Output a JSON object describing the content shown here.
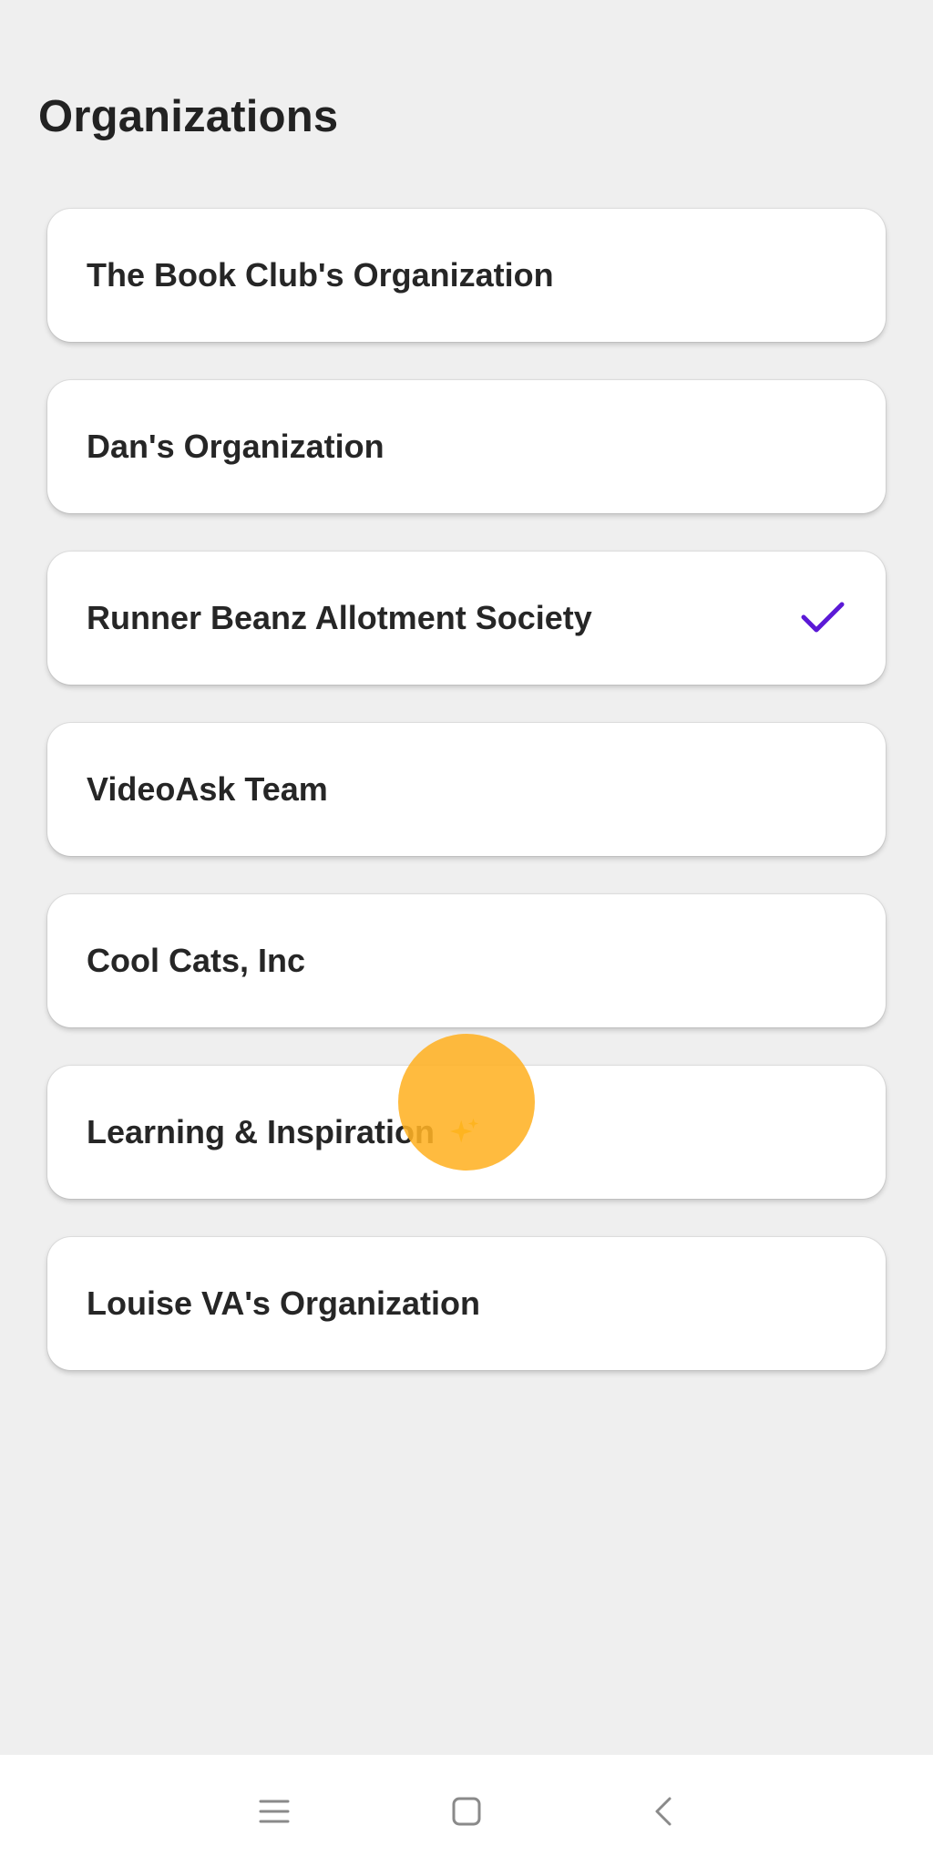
{
  "page": {
    "title": "Organizations"
  },
  "organizations": [
    {
      "name": "The Book Club's Organization",
      "selected": false
    },
    {
      "name": "Dan's Organization",
      "selected": false
    },
    {
      "name": "Runner Beanz Allotment Society",
      "selected": true
    },
    {
      "name": "VideoAsk Team",
      "selected": false
    },
    {
      "name": "Cool Cats, Inc",
      "selected": false
    },
    {
      "name": "Learning & Inspiration",
      "selected": false,
      "badge_icon": "sparkle-icon"
    },
    {
      "name": "Louise VA's Organization",
      "selected": false
    }
  ],
  "icons": {
    "selected": "checkmark-icon",
    "nav_menu": "menu-icon",
    "nav_home": "home-square-icon",
    "nav_back": "back-chevron-icon"
  },
  "colors": {
    "background": "#efefef",
    "card": "#ffffff",
    "text": "#262626",
    "accent_check": "#5b19d6",
    "touch_indicator": "#ffb224",
    "nav_icons": "#8a8a8a"
  }
}
